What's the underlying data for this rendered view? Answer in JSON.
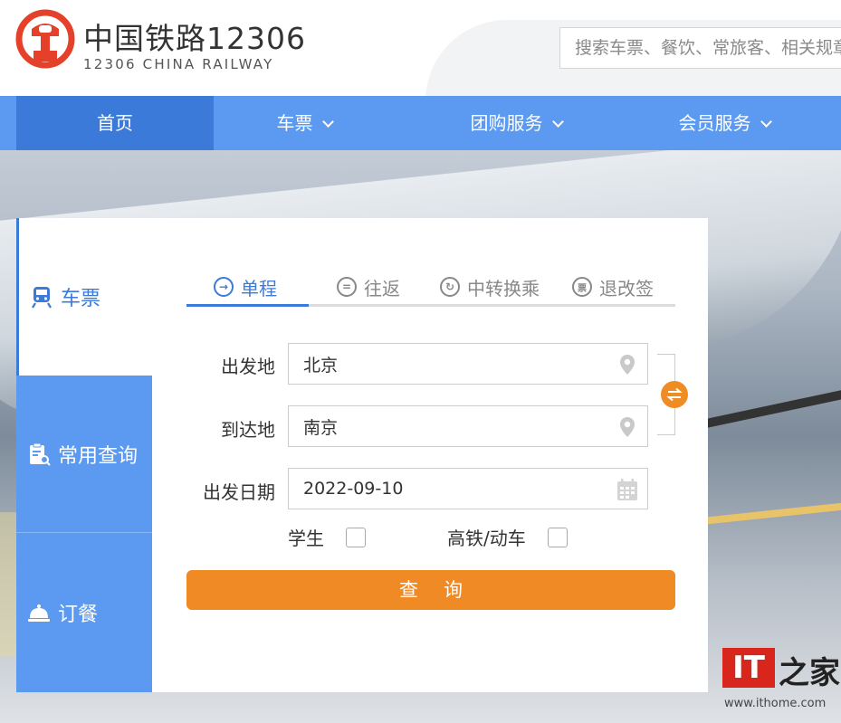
{
  "header": {
    "brand_cn": "中国铁路12306",
    "brand_en": "12306 CHINA RAILWAY",
    "search_placeholder": "搜索车票、餐饮、常旅客、相关规章"
  },
  "nav": {
    "items": [
      {
        "label": "首页"
      },
      {
        "label": "车票"
      },
      {
        "label": "团购服务"
      },
      {
        "label": "会员服务"
      }
    ]
  },
  "sidebar": {
    "items": [
      {
        "label": "车票",
        "icon": "train-icon"
      },
      {
        "label": "常用查询",
        "icon": "clipboard-search-icon"
      },
      {
        "label": "订餐",
        "icon": "food-cloche-icon"
      }
    ]
  },
  "ticket_form": {
    "tabs": [
      {
        "label": "单程",
        "icon": "arrow-circle-icon"
      },
      {
        "label": "往返",
        "icon": "equals-circle-icon"
      },
      {
        "label": "中转换乘",
        "icon": "transfer-circle-icon"
      },
      {
        "label": "退改签",
        "icon": "ticket-circle-icon"
      }
    ],
    "from_label": "出发地",
    "from_value": "北京",
    "to_label": "到达地",
    "to_value": "南京",
    "date_label": "出发日期",
    "date_value": "2022-09-10",
    "student_label": "学生",
    "highspeed_label": "高铁/动车",
    "query_label": "查询"
  },
  "watermark": {
    "badge": "IT",
    "text": "之家",
    "url": "www.ithome.com"
  },
  "colors": {
    "nav_blue": "#5b9af0",
    "nav_active": "#3c7ad9",
    "accent_orange": "#f08a24",
    "logo_red": "#e5402a"
  }
}
